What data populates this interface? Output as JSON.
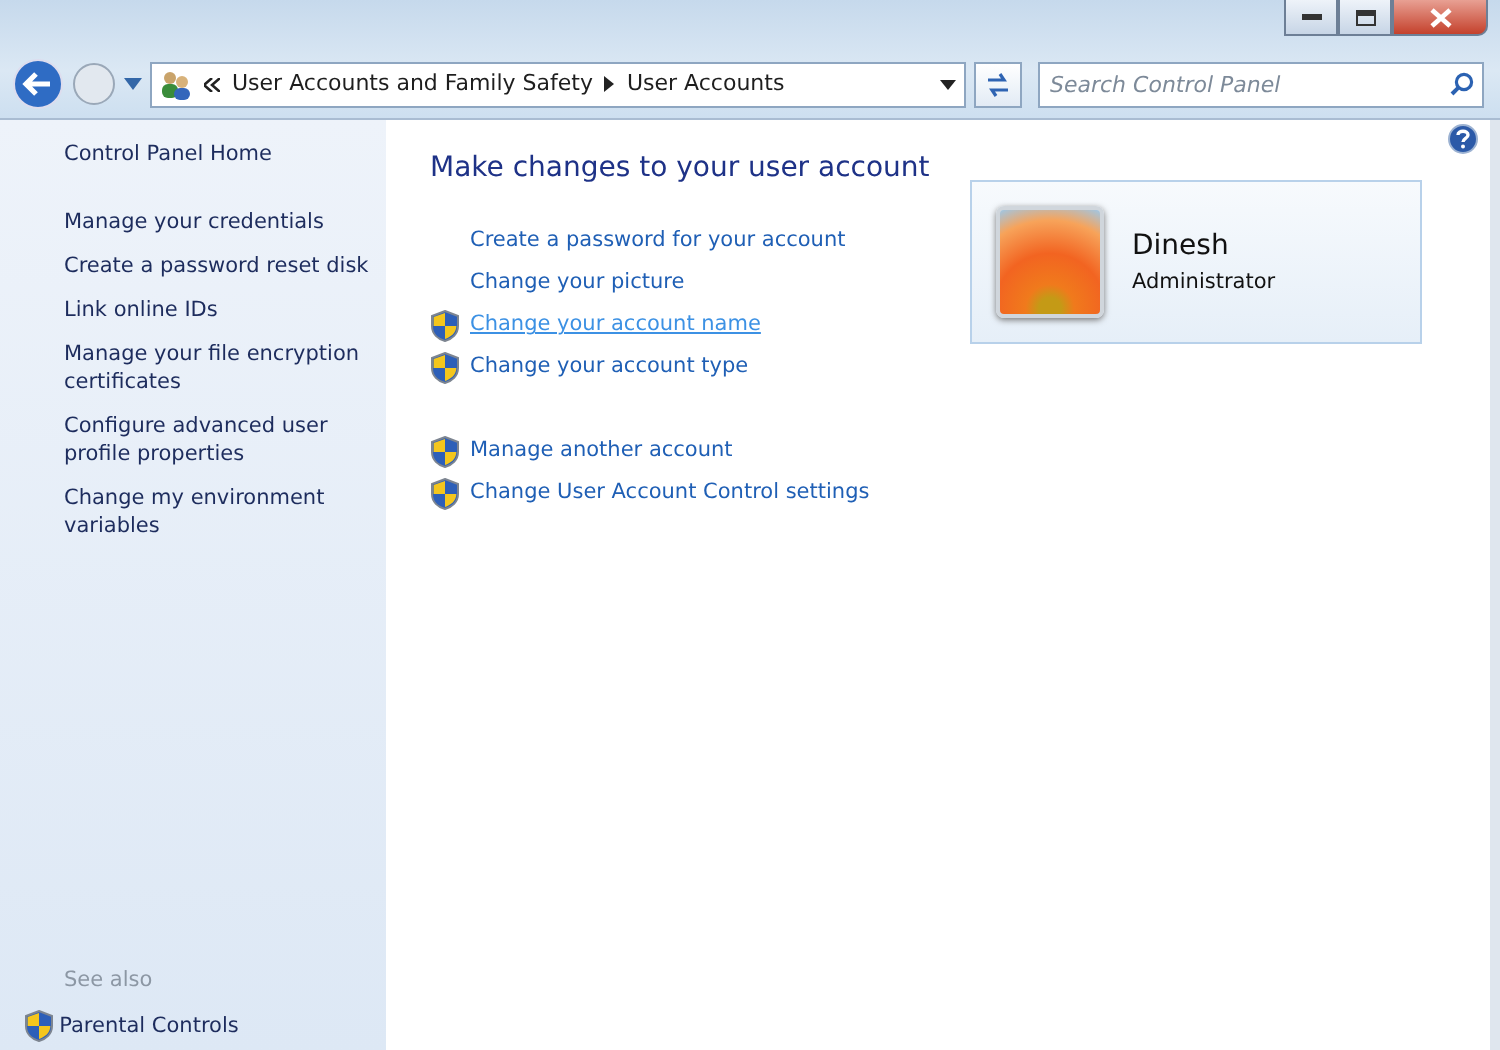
{
  "address_bar": {
    "path": [
      {
        "label": "User Accounts and Family Safety"
      },
      {
        "label": "User Accounts"
      }
    ]
  },
  "search": {
    "placeholder": "Search Control Panel"
  },
  "sidebar": {
    "home": "Control Panel Home",
    "items": [
      {
        "label": "Manage your credentials"
      },
      {
        "label": "Create a password reset disk"
      },
      {
        "label": "Link online IDs"
      },
      {
        "label": "Manage your file encryption certificates"
      },
      {
        "label": "Configure advanced user profile properties"
      },
      {
        "label": "Change my environment variables"
      }
    ],
    "see_also": {
      "heading": "See also",
      "items": [
        {
          "label": "Parental Controls",
          "shield": true
        }
      ]
    }
  },
  "main": {
    "title": "Make changes to your user account",
    "task_groups": [
      [
        {
          "label": "Create a password for your account",
          "shield": false,
          "hovered": false
        },
        {
          "label": "Change your picture",
          "shield": false,
          "hovered": false
        },
        {
          "label": "Change your account name",
          "shield": true,
          "hovered": true
        },
        {
          "label": "Change your account type",
          "shield": true,
          "hovered": false
        }
      ],
      [
        {
          "label": "Manage another account",
          "shield": true,
          "hovered": false
        },
        {
          "label": "Change User Account Control settings",
          "shield": true,
          "hovered": false
        }
      ]
    ],
    "account": {
      "name": "Dinesh",
      "role": "Administrator"
    }
  }
}
